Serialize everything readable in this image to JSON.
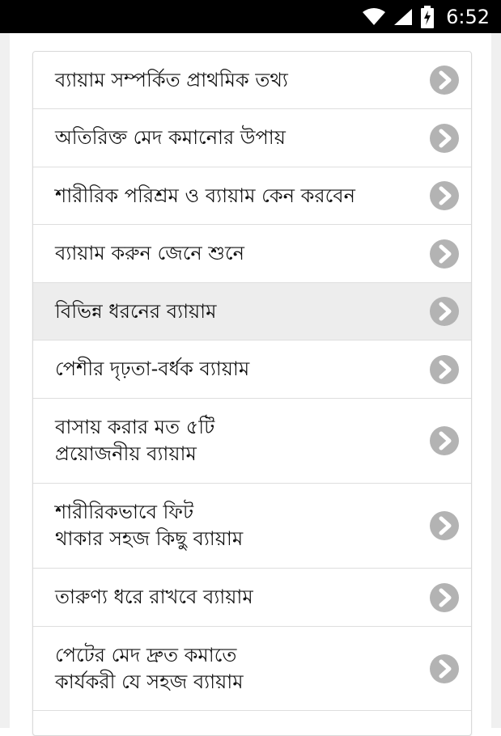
{
  "status_bar": {
    "time": "6:52",
    "icons": [
      "wifi-icon",
      "signal-icon",
      "battery-charging-icon"
    ]
  },
  "list": {
    "items": [
      {
        "label": "ব্যায়াম সম্পর্কিত প্রাথমিক তথ্য"
      },
      {
        "label": "অতিরিক্ত মেদ কমানোর উপায়"
      },
      {
        "label": "শারীরিক পরিশ্রম ও ব্যায়াম কেন করবেন"
      },
      {
        "label": "ব্যায়াম করুন জেনে শুনে"
      },
      {
        "label": "বিভিন্ন ধরনের ব্যায়াম",
        "selected": true
      },
      {
        "label": "পেশীর দৃঢ়তা-বর্ধক ব্যায়াম"
      },
      {
        "label": "বাসায় করার মত ৫টি\nপ্রয়োজনীয় ব্যায়াম"
      },
      {
        "label": "শারীরিকভাবে ফিট\nথাকার সহজ কিছু ব্যায়াম"
      },
      {
        "label": "তারুণ্য ধরে রাখবে ব্যায়াম"
      },
      {
        "label": "পেটের মেদ দ্রুত কমাতে\nকার্যকরী যে সহজ ব্যায়াম"
      }
    ],
    "chevron_icon": "chevron-right-circle-icon"
  },
  "colors": {
    "status_bar_bg": "#000000",
    "chevron": "#b3b3b3",
    "selected_row": "#ededed",
    "divider": "#dedede"
  }
}
